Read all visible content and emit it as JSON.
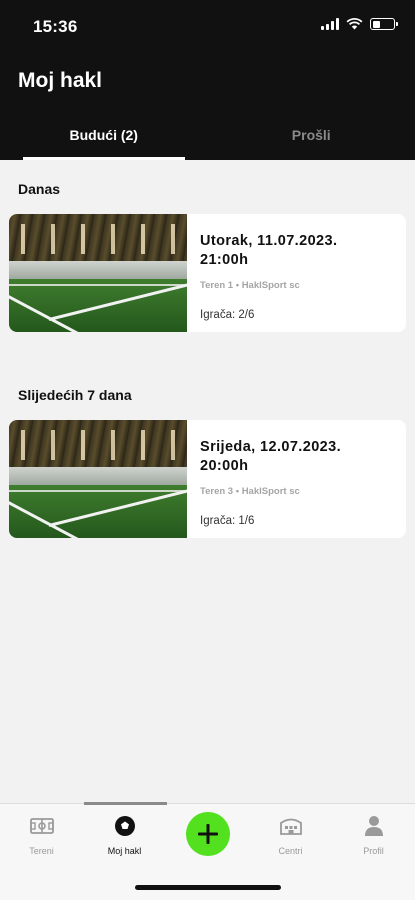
{
  "status": {
    "time": "15:36"
  },
  "header": {
    "title": "Moj hakl"
  },
  "tabs": [
    {
      "label": "Budući (2)",
      "active": true
    },
    {
      "label": "Prošli",
      "active": false
    }
  ],
  "sections": [
    {
      "label": "Danas",
      "booking": {
        "date": "Utorak, 11.07.2023.",
        "time": "21:00h",
        "venue": "Teren 1 • HaklSport sc",
        "players": "Igrača: 2/6"
      }
    },
    {
      "label": "Slijedećih 7 dana",
      "booking": {
        "date": "Srijeda, 12.07.2023.",
        "time": "20:00h",
        "venue": "Teren 3 • HaklSport sc",
        "players": "Igrača: 1/6"
      }
    }
  ],
  "nav": {
    "items": [
      {
        "label": "Tereni",
        "icon": "field-icon",
        "active": false
      },
      {
        "label": "Moj hakl",
        "icon": "soccer-ball-icon",
        "active": true
      },
      {
        "label": "Centri",
        "icon": "stadium-icon",
        "active": false
      },
      {
        "label": "Profil",
        "icon": "person-icon",
        "active": false
      }
    ],
    "add_icon": "plus-icon"
  },
  "colors": {
    "accent": "#52e01f",
    "header_bg": "#111111",
    "page_bg": "#f2f2f2"
  }
}
